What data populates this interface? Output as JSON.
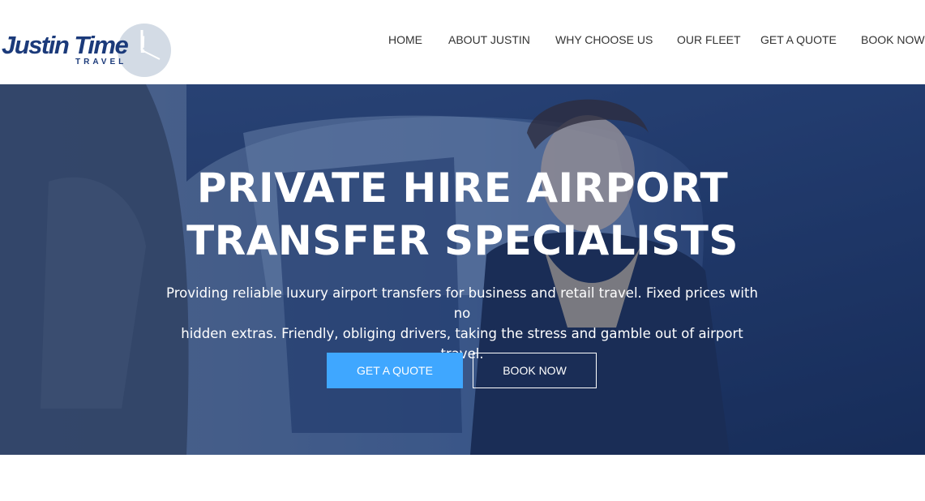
{
  "brand": {
    "name": "Justin Time",
    "sub": "TRAVEL",
    "logo_color": "#1b3a7a"
  },
  "nav": {
    "items": [
      {
        "label": "HOME"
      },
      {
        "label": "ABOUT JUSTIN"
      },
      {
        "label": "WHY CHOOSE US"
      },
      {
        "label": "OUR FLEET"
      },
      {
        "label": "GET A QUOTE"
      },
      {
        "label": "BOOK NOW"
      }
    ]
  },
  "hero": {
    "title_line1": "PRIVATE HIRE AIRPORT",
    "title_line2": "TRANSFER SPECIALISTS",
    "subtitle_line1": "Providing reliable luxury airport transfers for business and retail travel. Fixed prices with no",
    "subtitle_line2": "hidden extras. Friendly, obliging drivers, taking the stress and gamble out of airport travel.",
    "primary_button": "GET A QUOTE",
    "secondary_button": "BOOK NOW",
    "accent_color": "#3fa7ff"
  }
}
